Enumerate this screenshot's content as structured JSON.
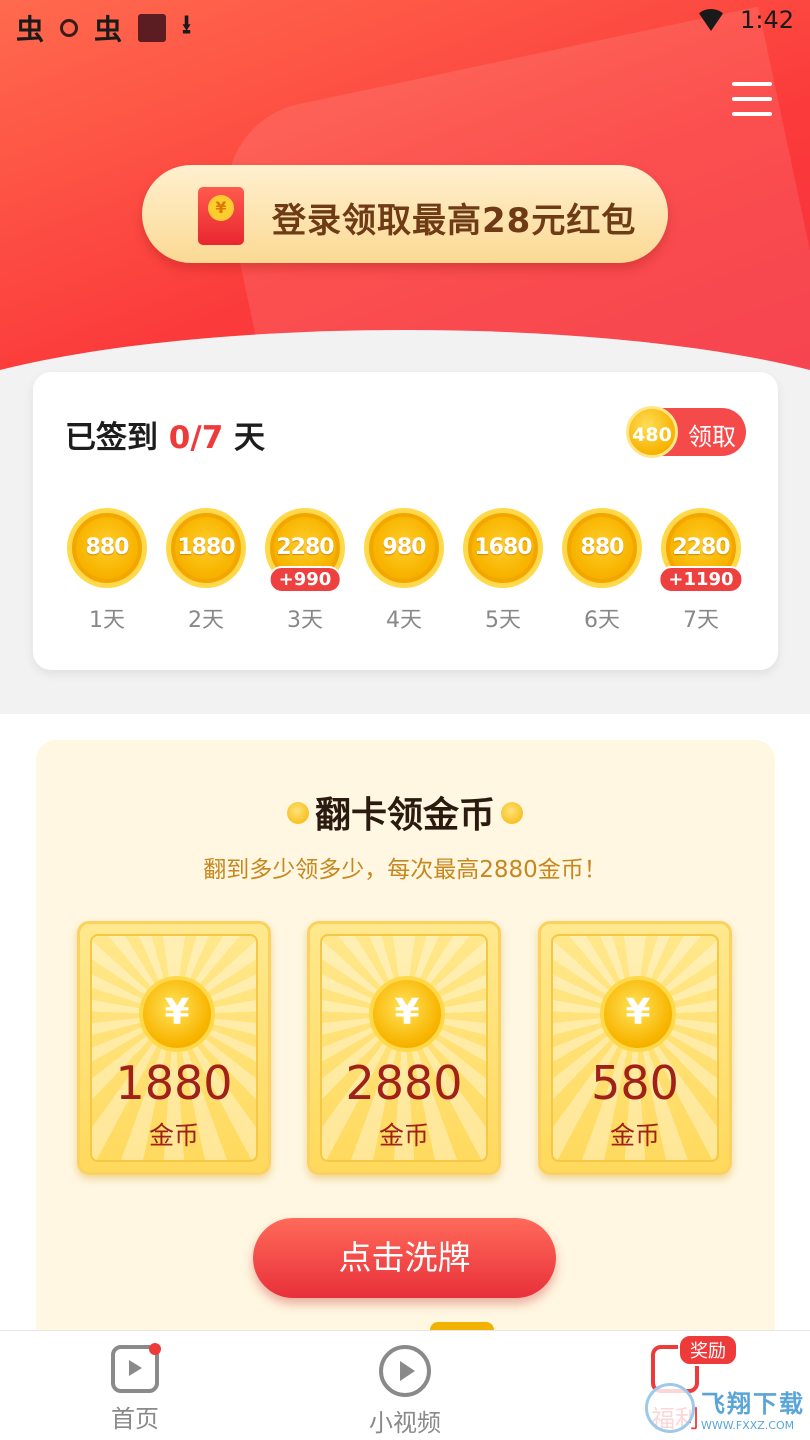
{
  "status_bar": {
    "time": "1:42",
    "left_icons": [
      "app-icon",
      "shield-icon",
      "app-icon",
      "square-app-icon",
      "download-icon"
    ]
  },
  "hero": {
    "menu_icon": "menu-icon",
    "login_banner": "登录领取最高28元红包"
  },
  "signin": {
    "title_prefix": "已签到 ",
    "count": "0/7",
    "title_suffix": " 天",
    "claim_coin": "480",
    "claim_label": "领取",
    "days": [
      {
        "coins": "880",
        "label": "1天",
        "bonus": ""
      },
      {
        "coins": "1880",
        "label": "2天",
        "bonus": ""
      },
      {
        "coins": "2280",
        "label": "3天",
        "bonus": "+990"
      },
      {
        "coins": "980",
        "label": "4天",
        "bonus": ""
      },
      {
        "coins": "1680",
        "label": "5天",
        "bonus": ""
      },
      {
        "coins": "880",
        "label": "6天",
        "bonus": ""
      },
      {
        "coins": "2280",
        "label": "7天",
        "bonus": "+1190"
      }
    ]
  },
  "flip": {
    "title": "翻卡领金币",
    "subtitle": "翻到多少领多少，每次最高2880金币！",
    "cards": [
      {
        "value": "1880",
        "unit": "金币"
      },
      {
        "value": "2880",
        "unit": "金币"
      },
      {
        "value": "580",
        "unit": "金币"
      }
    ],
    "coin_symbol": "¥",
    "shuffle_label": "点击洗牌"
  },
  "bottom_nav": {
    "items": [
      {
        "label": "首页",
        "icon": "home-play-icon"
      },
      {
        "label": "小视频",
        "icon": "video-play-icon"
      },
      {
        "label": "福利",
        "icon": "gift-icon"
      }
    ],
    "reward_badge": "奖励"
  },
  "watermark": {
    "text": "飞翔下载",
    "url": "WWW.FXXZ.COM"
  },
  "colors": {
    "brand_red": "#ef3a3a",
    "gold": "#f8b500",
    "banner_text": "#6e3b16"
  }
}
